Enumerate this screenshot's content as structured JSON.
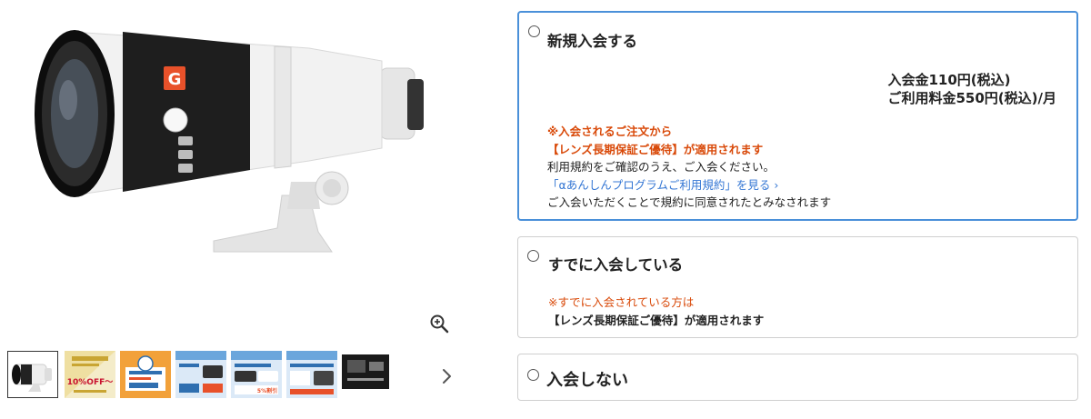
{
  "gallery": {
    "main_image": "lens-product-photo",
    "lens_badge": "G",
    "thumbnail_count": 7,
    "selected_thumbnail": 1,
    "thumb1_banner": "10%OFF〜",
    "thumb5_banner": "5%割引"
  },
  "options": [
    {
      "title": "新規入会する",
      "fee_line1": "入会金110円(税込)",
      "fee_line2": "ご利用料金550円(税込)/月",
      "note_red1": "※入会されるご注文から",
      "note_red2": "【レンズ長期保証ご優待】が適用されます",
      "note_text": "利用規約をご確認のうえ、ご入会ください。",
      "link_text": "「αあんしんプログラムご利用規約」を見る ›",
      "note_agree": "ご入会いただくことで規約に同意されたとみなされます"
    },
    {
      "title": "すでに入会している",
      "note_red": "※すでに入会されている方は",
      "note_bold": "【レンズ長期保証ご優待】が適用されます"
    },
    {
      "title": "入会しない"
    }
  ],
  "colors": {
    "accent_border": "#4a90d9",
    "warning_text": "#d94a0a",
    "link": "#3577d4",
    "lens_badge": "#e8512a"
  }
}
